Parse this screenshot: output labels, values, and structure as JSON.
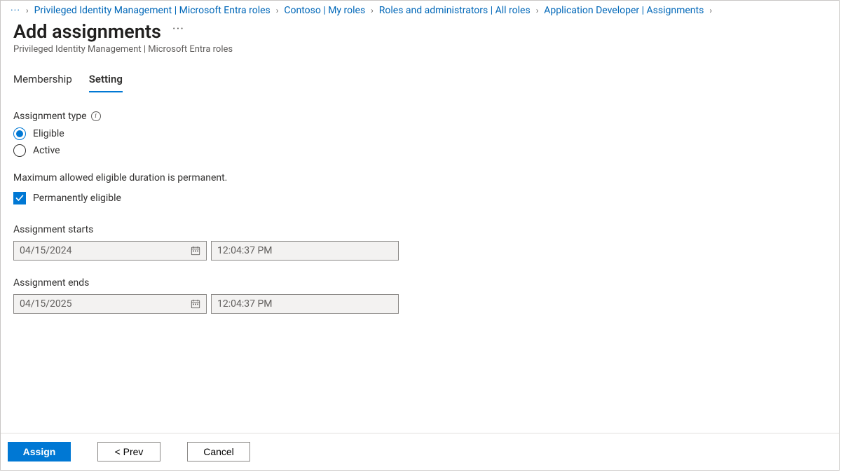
{
  "breadcrumb": {
    "more": "···",
    "items": [
      "Privileged Identity Management | Microsoft Entra roles",
      "Contoso | My roles",
      "Roles and administrators | All roles",
      "Application Developer | Assignments"
    ]
  },
  "header": {
    "title": "Add assignments",
    "more": "···",
    "subtitle": "Privileged Identity Management | Microsoft Entra roles"
  },
  "tabs": {
    "membership": "Membership",
    "setting": "Setting",
    "active": "setting"
  },
  "form": {
    "assignment_type_label": "Assignment type",
    "radios": {
      "eligible": "Eligible",
      "active": "Active",
      "selected": "eligible"
    },
    "hint": "Maximum allowed eligible duration is permanent.",
    "permanent_checkbox_label": "Permanently eligible",
    "permanent_checked": true,
    "starts_label": "Assignment starts",
    "starts_date": "04/15/2024",
    "starts_time": "12:04:37 PM",
    "ends_label": "Assignment ends",
    "ends_date": "04/15/2025",
    "ends_time": "12:04:37 PM"
  },
  "footer": {
    "assign": "Assign",
    "prev": "<  Prev",
    "cancel": "Cancel"
  }
}
